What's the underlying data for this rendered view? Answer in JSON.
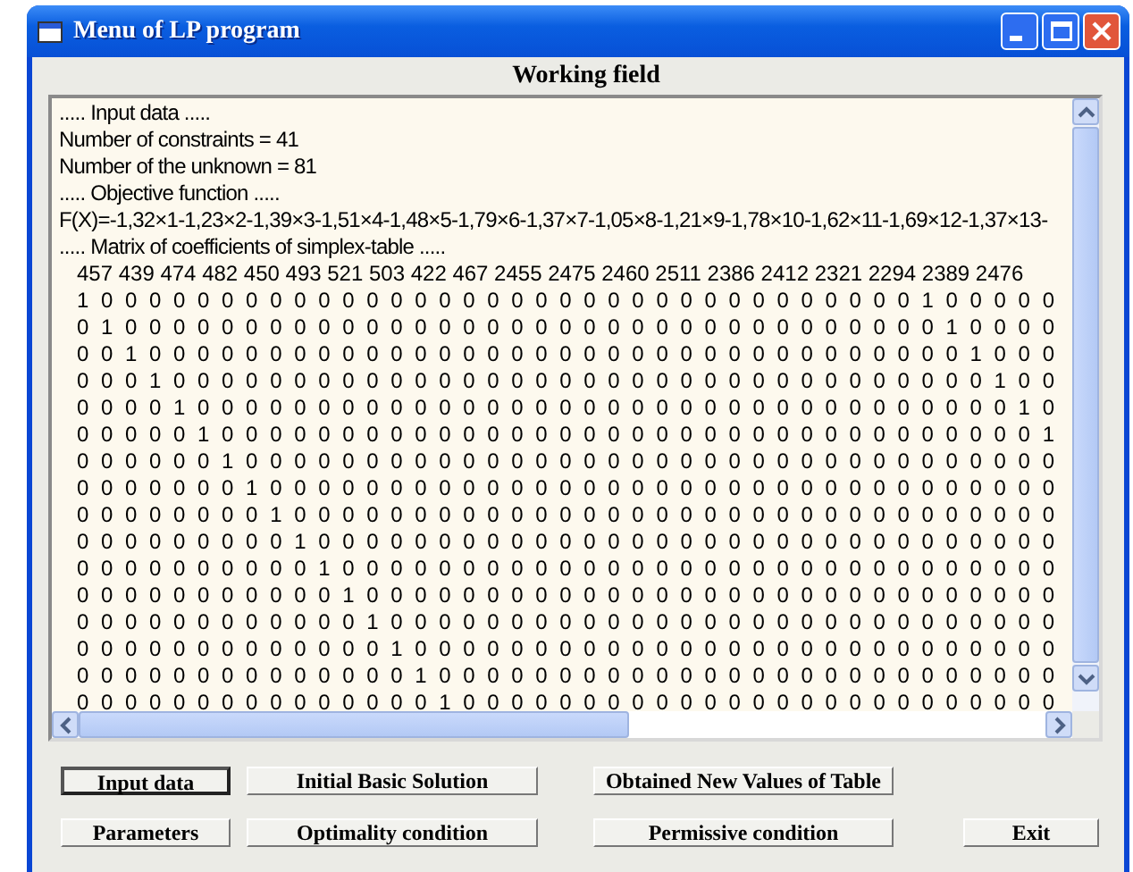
{
  "window": {
    "title": "Menu of LP program"
  },
  "working_field": {
    "heading": "Working field",
    "lines": [
      {
        "kind": "text",
        "text": "..... Input data ....."
      },
      {
        "kind": "text",
        "text": "Number of constraints = 41"
      },
      {
        "kind": "text",
        "text": "Number of the unknown = 81"
      },
      {
        "kind": "text",
        "text": "..... Objective function ....."
      },
      {
        "kind": "text",
        "text": "F(X)=-1,32×1-1,23×2-1,39×3-1,51×4-1,48×5-1,79×6-1,37×7-1,05×8-1,21×9-1,78×10-1,62×11-1,69×12-1,37×13-"
      },
      {
        "kind": "text",
        "text": "..... Matrix of coefficients of simplex-table ....."
      },
      {
        "kind": "header",
        "text": "457 439 474 482 450 493 521 503 422 467 2455 2475 2460 2511 2386 2412 2321 2294 2389 2476"
      },
      {
        "kind": "row",
        "text": "1 0 0 0 0 0 0 0 0 0 0 0 0 0 0 0 0 0 0 0 0 0 0 0 0 0 0 0 0 0 0 0 0 0 0 1 0 0 0 0 0"
      },
      {
        "kind": "row",
        "text": "0 1 0 0 0 0 0 0 0 0 0 0 0 0 0 0 0 0 0 0 0 0 0 0 0 0 0 0 0 0 0 0 0 0 0 0 1 0 0 0 0"
      },
      {
        "kind": "row",
        "text": "0 0 1 0 0 0 0 0 0 0 0 0 0 0 0 0 0 0 0 0 0 0 0 0 0 0 0 0 0 0 0 0 0 0 0 0 0 1 0 0 0"
      },
      {
        "kind": "row",
        "text": "0 0 0 1 0 0 0 0 0 0 0 0 0 0 0 0 0 0 0 0 0 0 0 0 0 0 0 0 0 0 0 0 0 0 0 0 0 0 1 0 0"
      },
      {
        "kind": "row",
        "text": "0 0 0 0 1 0 0 0 0 0 0 0 0 0 0 0 0 0 0 0 0 0 0 0 0 0 0 0 0 0 0 0 0 0 0 0 0 0 0 1 0"
      },
      {
        "kind": "row",
        "text": "0 0 0 0 0 1 0 0 0 0 0 0 0 0 0 0 0 0 0 0 0 0 0 0 0 0 0 0 0 0 0 0 0 0 0 0 0 0 0 0 1"
      },
      {
        "kind": "row",
        "text": "0 0 0 0 0 0 1 0 0 0 0 0 0 0 0 0 0 0 0 0 0 0 0 0 0 0 0 0 0 0 0 0 0 0 0 0 0 0 0 0 0"
      },
      {
        "kind": "row",
        "text": "0 0 0 0 0 0 0 1 0 0 0 0 0 0 0 0 0 0 0 0 0 0 0 0 0 0 0 0 0 0 0 0 0 0 0 0 0 0 0 0 0"
      },
      {
        "kind": "row",
        "text": "0 0 0 0 0 0 0 0 1 0 0 0 0 0 0 0 0 0 0 0 0 0 0 0 0 0 0 0 0 0 0 0 0 0 0 0 0 0 0 0 0"
      },
      {
        "kind": "row",
        "text": "0 0 0 0 0 0 0 0 0 1 0 0 0 0 0 0 0 0 0 0 0 0 0 0 0 0 0 0 0 0 0 0 0 0 0 0 0 0 0 0 0"
      },
      {
        "kind": "row",
        "text": "0 0 0 0 0 0 0 0 0 0 1 0 0 0 0 0 0 0 0 0 0 0 0 0 0 0 0 0 0 0 0 0 0 0 0 0 0 0 0 0 0"
      },
      {
        "kind": "row",
        "text": "0 0 0 0 0 0 0 0 0 0 0 1 0 0 0 0 0 0 0 0 0 0 0 0 0 0 0 0 0 0 0 0 0 0 0 0 0 0 0 0 0"
      },
      {
        "kind": "row",
        "text": "0 0 0 0 0 0 0 0 0 0 0 0 1 0 0 0 0 0 0 0 0 0 0 0 0 0 0 0 0 0 0 0 0 0 0 0 0 0 0 0 0"
      },
      {
        "kind": "row",
        "text": "0 0 0 0 0 0 0 0 0 0 0 0 0 1 0 0 0 0 0 0 0 0 0 0 0 0 0 0 0 0 0 0 0 0 0 0 0 0 0 0 0"
      },
      {
        "kind": "row",
        "text": "0 0 0 0 0 0 0 0 0 0 0 0 0 0 1 0 0 0 0 0 0 0 0 0 0 0 0 0 0 0 0 0 0 0 0 0 0 0 0 0 0"
      },
      {
        "kind": "row",
        "text": "0 0 0 0 0 0 0 0 0 0 0 0 0 0 0 1 0 0 0 0 0 0 0 0 0 0 0 0 0 0 0 0 0 0 0 0 0 0 0 0 0"
      }
    ]
  },
  "buttons": [
    {
      "label": "Input data",
      "focused": true
    },
    {
      "label": "Initial Basic Solution",
      "focused": false
    },
    {
      "label": "Obtained New Values of Table",
      "focused": false
    },
    {
      "label": "Parameters",
      "focused": false
    },
    {
      "label": "Optimality condition",
      "focused": false
    },
    {
      "label": "Permissive condition",
      "focused": false
    },
    {
      "label": "Exit",
      "focused": false
    }
  ]
}
